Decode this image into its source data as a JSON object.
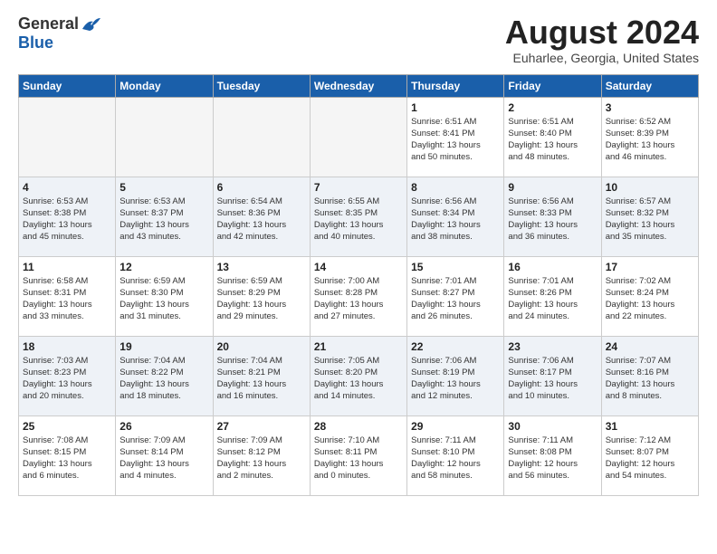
{
  "header": {
    "logo_general": "General",
    "logo_blue": "Blue",
    "title": "August 2024",
    "location": "Euharlee, Georgia, United States"
  },
  "days_of_week": [
    "Sunday",
    "Monday",
    "Tuesday",
    "Wednesday",
    "Thursday",
    "Friday",
    "Saturday"
  ],
  "weeks": [
    [
      {
        "day": "",
        "info": ""
      },
      {
        "day": "",
        "info": ""
      },
      {
        "day": "",
        "info": ""
      },
      {
        "day": "",
        "info": ""
      },
      {
        "day": "1",
        "info": "Sunrise: 6:51 AM\nSunset: 8:41 PM\nDaylight: 13 hours\nand 50 minutes."
      },
      {
        "day": "2",
        "info": "Sunrise: 6:51 AM\nSunset: 8:40 PM\nDaylight: 13 hours\nand 48 minutes."
      },
      {
        "day": "3",
        "info": "Sunrise: 6:52 AM\nSunset: 8:39 PM\nDaylight: 13 hours\nand 46 minutes."
      }
    ],
    [
      {
        "day": "4",
        "info": "Sunrise: 6:53 AM\nSunset: 8:38 PM\nDaylight: 13 hours\nand 45 minutes."
      },
      {
        "day": "5",
        "info": "Sunrise: 6:53 AM\nSunset: 8:37 PM\nDaylight: 13 hours\nand 43 minutes."
      },
      {
        "day": "6",
        "info": "Sunrise: 6:54 AM\nSunset: 8:36 PM\nDaylight: 13 hours\nand 42 minutes."
      },
      {
        "day": "7",
        "info": "Sunrise: 6:55 AM\nSunset: 8:35 PM\nDaylight: 13 hours\nand 40 minutes."
      },
      {
        "day": "8",
        "info": "Sunrise: 6:56 AM\nSunset: 8:34 PM\nDaylight: 13 hours\nand 38 minutes."
      },
      {
        "day": "9",
        "info": "Sunrise: 6:56 AM\nSunset: 8:33 PM\nDaylight: 13 hours\nand 36 minutes."
      },
      {
        "day": "10",
        "info": "Sunrise: 6:57 AM\nSunset: 8:32 PM\nDaylight: 13 hours\nand 35 minutes."
      }
    ],
    [
      {
        "day": "11",
        "info": "Sunrise: 6:58 AM\nSunset: 8:31 PM\nDaylight: 13 hours\nand 33 minutes."
      },
      {
        "day": "12",
        "info": "Sunrise: 6:59 AM\nSunset: 8:30 PM\nDaylight: 13 hours\nand 31 minutes."
      },
      {
        "day": "13",
        "info": "Sunrise: 6:59 AM\nSunset: 8:29 PM\nDaylight: 13 hours\nand 29 minutes."
      },
      {
        "day": "14",
        "info": "Sunrise: 7:00 AM\nSunset: 8:28 PM\nDaylight: 13 hours\nand 27 minutes."
      },
      {
        "day": "15",
        "info": "Sunrise: 7:01 AM\nSunset: 8:27 PM\nDaylight: 13 hours\nand 26 minutes."
      },
      {
        "day": "16",
        "info": "Sunrise: 7:01 AM\nSunset: 8:26 PM\nDaylight: 13 hours\nand 24 minutes."
      },
      {
        "day": "17",
        "info": "Sunrise: 7:02 AM\nSunset: 8:24 PM\nDaylight: 13 hours\nand 22 minutes."
      }
    ],
    [
      {
        "day": "18",
        "info": "Sunrise: 7:03 AM\nSunset: 8:23 PM\nDaylight: 13 hours\nand 20 minutes."
      },
      {
        "day": "19",
        "info": "Sunrise: 7:04 AM\nSunset: 8:22 PM\nDaylight: 13 hours\nand 18 minutes."
      },
      {
        "day": "20",
        "info": "Sunrise: 7:04 AM\nSunset: 8:21 PM\nDaylight: 13 hours\nand 16 minutes."
      },
      {
        "day": "21",
        "info": "Sunrise: 7:05 AM\nSunset: 8:20 PM\nDaylight: 13 hours\nand 14 minutes."
      },
      {
        "day": "22",
        "info": "Sunrise: 7:06 AM\nSunset: 8:19 PM\nDaylight: 13 hours\nand 12 minutes."
      },
      {
        "day": "23",
        "info": "Sunrise: 7:06 AM\nSunset: 8:17 PM\nDaylight: 13 hours\nand 10 minutes."
      },
      {
        "day": "24",
        "info": "Sunrise: 7:07 AM\nSunset: 8:16 PM\nDaylight: 13 hours\nand 8 minutes."
      }
    ],
    [
      {
        "day": "25",
        "info": "Sunrise: 7:08 AM\nSunset: 8:15 PM\nDaylight: 13 hours\nand 6 minutes."
      },
      {
        "day": "26",
        "info": "Sunrise: 7:09 AM\nSunset: 8:14 PM\nDaylight: 13 hours\nand 4 minutes."
      },
      {
        "day": "27",
        "info": "Sunrise: 7:09 AM\nSunset: 8:12 PM\nDaylight: 13 hours\nand 2 minutes."
      },
      {
        "day": "28",
        "info": "Sunrise: 7:10 AM\nSunset: 8:11 PM\nDaylight: 13 hours\nand 0 minutes."
      },
      {
        "day": "29",
        "info": "Sunrise: 7:11 AM\nSunset: 8:10 PM\nDaylight: 12 hours\nand 58 minutes."
      },
      {
        "day": "30",
        "info": "Sunrise: 7:11 AM\nSunset: 8:08 PM\nDaylight: 12 hours\nand 56 minutes."
      },
      {
        "day": "31",
        "info": "Sunrise: 7:12 AM\nSunset: 8:07 PM\nDaylight: 12 hours\nand 54 minutes."
      }
    ]
  ]
}
